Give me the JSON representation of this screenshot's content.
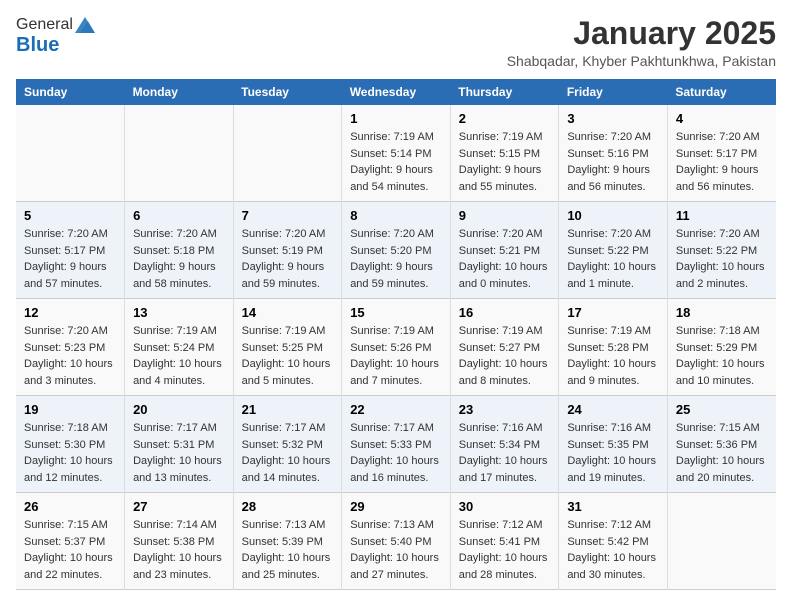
{
  "header": {
    "logo_general": "General",
    "logo_blue": "Blue",
    "title": "January 2025",
    "subtitle": "Shabqadar, Khyber Pakhtunkhwa, Pakistan"
  },
  "days_of_week": [
    "Sunday",
    "Monday",
    "Tuesday",
    "Wednesday",
    "Thursday",
    "Friday",
    "Saturday"
  ],
  "weeks": [
    {
      "days": [
        {
          "number": "",
          "info": ""
        },
        {
          "number": "",
          "info": ""
        },
        {
          "number": "",
          "info": ""
        },
        {
          "number": "1",
          "info": "Sunrise: 7:19 AM\nSunset: 5:14 PM\nDaylight: 9 hours\nand 54 minutes."
        },
        {
          "number": "2",
          "info": "Sunrise: 7:19 AM\nSunset: 5:15 PM\nDaylight: 9 hours\nand 55 minutes."
        },
        {
          "number": "3",
          "info": "Sunrise: 7:20 AM\nSunset: 5:16 PM\nDaylight: 9 hours\nand 56 minutes."
        },
        {
          "number": "4",
          "info": "Sunrise: 7:20 AM\nSunset: 5:17 PM\nDaylight: 9 hours\nand 56 minutes."
        }
      ]
    },
    {
      "days": [
        {
          "number": "5",
          "info": "Sunrise: 7:20 AM\nSunset: 5:17 PM\nDaylight: 9 hours\nand 57 minutes."
        },
        {
          "number": "6",
          "info": "Sunrise: 7:20 AM\nSunset: 5:18 PM\nDaylight: 9 hours\nand 58 minutes."
        },
        {
          "number": "7",
          "info": "Sunrise: 7:20 AM\nSunset: 5:19 PM\nDaylight: 9 hours\nand 59 minutes."
        },
        {
          "number": "8",
          "info": "Sunrise: 7:20 AM\nSunset: 5:20 PM\nDaylight: 9 hours\nand 59 minutes."
        },
        {
          "number": "9",
          "info": "Sunrise: 7:20 AM\nSunset: 5:21 PM\nDaylight: 10 hours\nand 0 minutes."
        },
        {
          "number": "10",
          "info": "Sunrise: 7:20 AM\nSunset: 5:22 PM\nDaylight: 10 hours\nand 1 minute."
        },
        {
          "number": "11",
          "info": "Sunrise: 7:20 AM\nSunset: 5:22 PM\nDaylight: 10 hours\nand 2 minutes."
        }
      ]
    },
    {
      "days": [
        {
          "number": "12",
          "info": "Sunrise: 7:20 AM\nSunset: 5:23 PM\nDaylight: 10 hours\nand 3 minutes."
        },
        {
          "number": "13",
          "info": "Sunrise: 7:19 AM\nSunset: 5:24 PM\nDaylight: 10 hours\nand 4 minutes."
        },
        {
          "number": "14",
          "info": "Sunrise: 7:19 AM\nSunset: 5:25 PM\nDaylight: 10 hours\nand 5 minutes."
        },
        {
          "number": "15",
          "info": "Sunrise: 7:19 AM\nSunset: 5:26 PM\nDaylight: 10 hours\nand 7 minutes."
        },
        {
          "number": "16",
          "info": "Sunrise: 7:19 AM\nSunset: 5:27 PM\nDaylight: 10 hours\nand 8 minutes."
        },
        {
          "number": "17",
          "info": "Sunrise: 7:19 AM\nSunset: 5:28 PM\nDaylight: 10 hours\nand 9 minutes."
        },
        {
          "number": "18",
          "info": "Sunrise: 7:18 AM\nSunset: 5:29 PM\nDaylight: 10 hours\nand 10 minutes."
        }
      ]
    },
    {
      "days": [
        {
          "number": "19",
          "info": "Sunrise: 7:18 AM\nSunset: 5:30 PM\nDaylight: 10 hours\nand 12 minutes."
        },
        {
          "number": "20",
          "info": "Sunrise: 7:17 AM\nSunset: 5:31 PM\nDaylight: 10 hours\nand 13 minutes."
        },
        {
          "number": "21",
          "info": "Sunrise: 7:17 AM\nSunset: 5:32 PM\nDaylight: 10 hours\nand 14 minutes."
        },
        {
          "number": "22",
          "info": "Sunrise: 7:17 AM\nSunset: 5:33 PM\nDaylight: 10 hours\nand 16 minutes."
        },
        {
          "number": "23",
          "info": "Sunrise: 7:16 AM\nSunset: 5:34 PM\nDaylight: 10 hours\nand 17 minutes."
        },
        {
          "number": "24",
          "info": "Sunrise: 7:16 AM\nSunset: 5:35 PM\nDaylight: 10 hours\nand 19 minutes."
        },
        {
          "number": "25",
          "info": "Sunrise: 7:15 AM\nSunset: 5:36 PM\nDaylight: 10 hours\nand 20 minutes."
        }
      ]
    },
    {
      "days": [
        {
          "number": "26",
          "info": "Sunrise: 7:15 AM\nSunset: 5:37 PM\nDaylight: 10 hours\nand 22 minutes."
        },
        {
          "number": "27",
          "info": "Sunrise: 7:14 AM\nSunset: 5:38 PM\nDaylight: 10 hours\nand 23 minutes."
        },
        {
          "number": "28",
          "info": "Sunrise: 7:13 AM\nSunset: 5:39 PM\nDaylight: 10 hours\nand 25 minutes."
        },
        {
          "number": "29",
          "info": "Sunrise: 7:13 AM\nSunset: 5:40 PM\nDaylight: 10 hours\nand 27 minutes."
        },
        {
          "number": "30",
          "info": "Sunrise: 7:12 AM\nSunset: 5:41 PM\nDaylight: 10 hours\nand 28 minutes."
        },
        {
          "number": "31",
          "info": "Sunrise: 7:12 AM\nSunset: 5:42 PM\nDaylight: 10 hours\nand 30 minutes."
        },
        {
          "number": "",
          "info": ""
        }
      ]
    }
  ]
}
